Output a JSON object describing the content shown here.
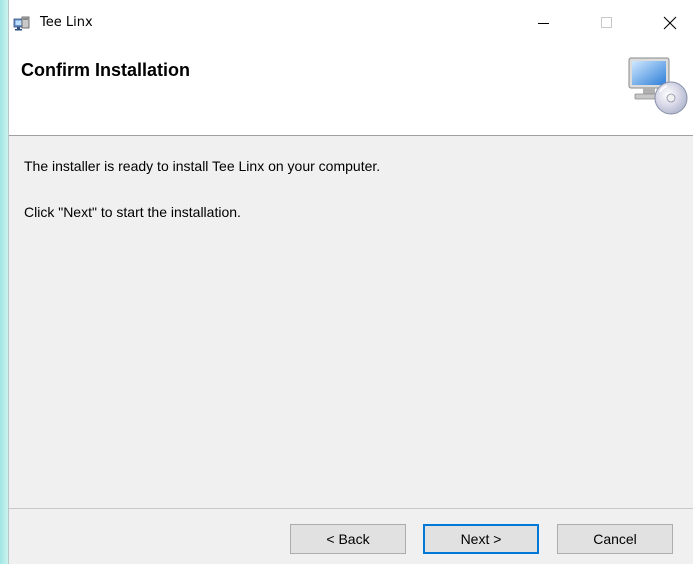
{
  "window": {
    "title": "Tee Linx",
    "controls": {
      "minimize": "minimize-icon",
      "maximize": "maximize-icon",
      "close": "close-icon"
    }
  },
  "header": {
    "title": "Confirm Installation",
    "icon": "computer-cd-icon"
  },
  "body": {
    "line1": "The installer is ready to install Tee Linx on your computer.",
    "line2": "Click \"Next\" to start the installation."
  },
  "buttons": {
    "back": "< Back",
    "next": "Next >",
    "cancel": "Cancel"
  },
  "colors": {
    "window_bg": "#f0f0f0",
    "header_bg": "#ffffff",
    "default_button_border": "#0078d7"
  }
}
